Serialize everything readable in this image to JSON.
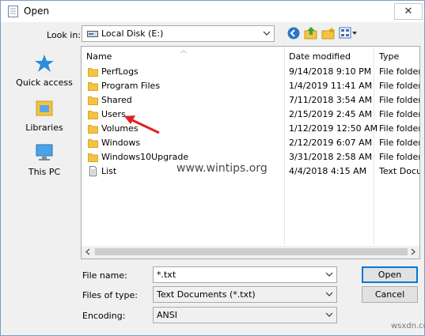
{
  "window": {
    "title": "Open",
    "close_glyph": "✕"
  },
  "lookin": {
    "label": "Look in:",
    "value": "Local Disk (E:)"
  },
  "toolbar_icons": [
    "back-icon",
    "up-folder-icon",
    "new-folder-icon",
    "view-menu-icon"
  ],
  "places": [
    {
      "label": "Quick access",
      "icon": "quick-access-icon"
    },
    {
      "label": "Libraries",
      "icon": "libraries-icon"
    },
    {
      "label": "This PC",
      "icon": "this-pc-icon"
    }
  ],
  "columns": {
    "name": "Name",
    "date": "Date modified",
    "type": "Type"
  },
  "files": [
    {
      "name": "PerfLogs",
      "date": "9/14/2018 9:10 PM",
      "type": "File folder",
      "icon": "folder-icon"
    },
    {
      "name": "Program Files",
      "date": "1/4/2019 11:41 AM",
      "type": "File folder",
      "icon": "folder-icon"
    },
    {
      "name": "Shared",
      "date": "7/11/2018 3:54 AM",
      "type": "File folder",
      "icon": "folder-icon"
    },
    {
      "name": "Users",
      "date": "2/15/2019 2:45 AM",
      "type": "File folder",
      "icon": "folder-icon"
    },
    {
      "name": "Volumes",
      "date": "1/12/2019 12:50 AM",
      "type": "File folder",
      "icon": "folder-icon"
    },
    {
      "name": "Windows",
      "date": "2/12/2019 6:07 AM",
      "type": "File folder",
      "icon": "folder-icon"
    },
    {
      "name": "Windows10Upgrade",
      "date": "3/31/2018 2:58 AM",
      "type": "File folder",
      "icon": "folder-icon"
    },
    {
      "name": "List",
      "date": "4/4/2018 4:15 AM",
      "type": "Text Docu",
      "icon": "text-file-icon"
    }
  ],
  "watermark": "www.wintips.org",
  "form": {
    "filename_label": "File name:",
    "filename_value": "*.txt",
    "filetype_label": "Files of type:",
    "filetype_value": "Text Documents (*.txt)",
    "encoding_label": "Encoding:",
    "encoding_value": "ANSI",
    "open_label": "Open",
    "cancel_label": "Cancel"
  },
  "site_mark": "wsxdn.com",
  "colors": {
    "accent": "#0078d7",
    "folder": "#f5c342",
    "annotation": "#e02020"
  }
}
